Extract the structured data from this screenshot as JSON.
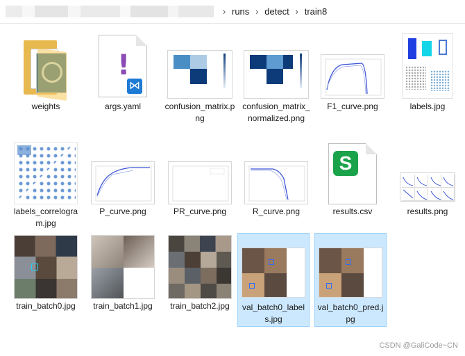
{
  "breadcrumb": [
    "runs",
    "detect",
    "train8"
  ],
  "files": [
    {
      "name": "weights"
    },
    {
      "name": "args.yaml"
    },
    {
      "name": "confusion_matrix.png"
    },
    {
      "name": "confusion_matrix_normalized.png"
    },
    {
      "name": "F1_curve.png"
    },
    {
      "name": "labels.jpg"
    },
    {
      "name": "labels_correlogram.jpg"
    },
    {
      "name": "P_curve.png"
    },
    {
      "name": "PR_curve.png"
    },
    {
      "name": "R_curve.png"
    },
    {
      "name": "results.csv"
    },
    {
      "name": "results.png"
    },
    {
      "name": "train_batch0.jpg"
    },
    {
      "name": "train_batch1.jpg"
    },
    {
      "name": "train_batch2.jpg"
    },
    {
      "name": "val_batch0_labels.jpg",
      "selected": true
    },
    {
      "name": "val_batch0_pred.jpg",
      "selected": true
    }
  ],
  "watermark": "CSDN @GaliCode~CN",
  "colors": {
    "selection": "#cce8ff",
    "selection_border": "#99d1ff",
    "folder": "#f5c95a",
    "csv_green": "#1aa34a"
  }
}
